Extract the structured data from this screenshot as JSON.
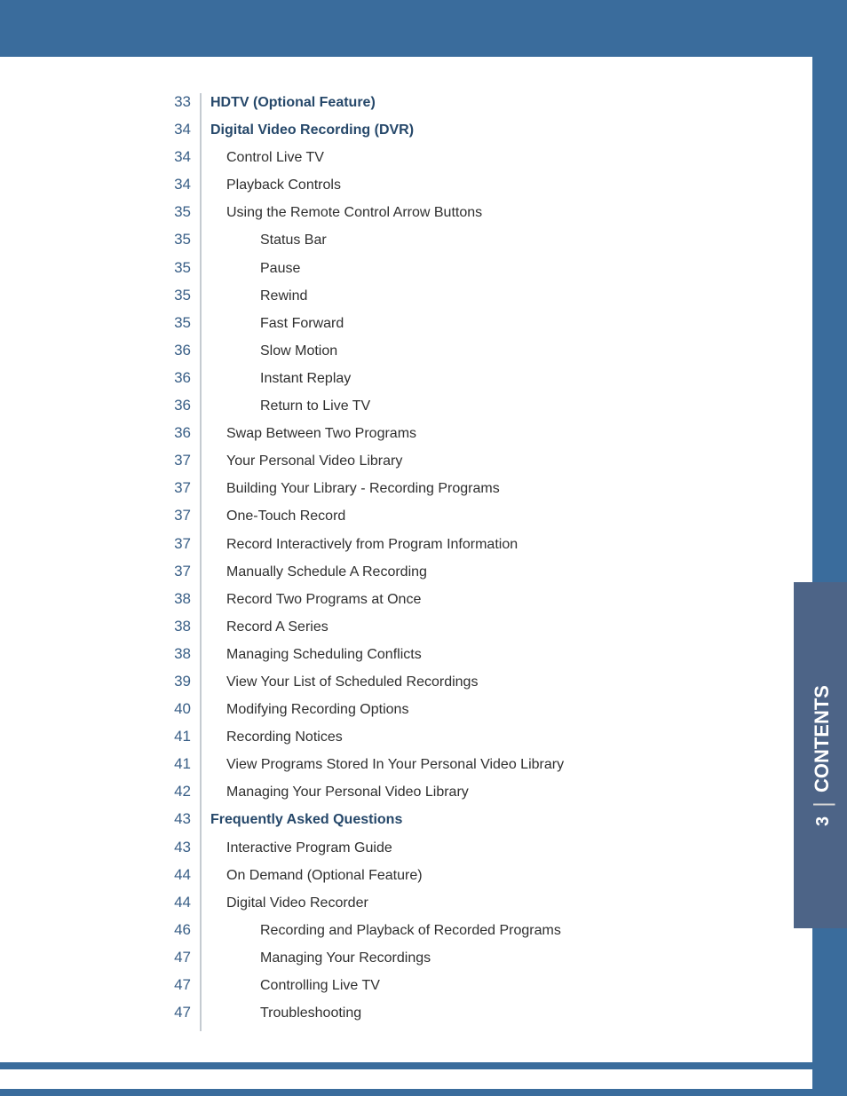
{
  "side_tab": {
    "page": "3",
    "separator": "|",
    "title": "CONTENTS"
  },
  "toc": [
    {
      "page": "33",
      "title": "HDTV  (Optional Feature)",
      "level": 0,
      "bold": true
    },
    {
      "page": "34",
      "title": "Digital Video Recording (DVR)",
      "level": 0,
      "bold": true
    },
    {
      "page": "34",
      "title": "Control Live TV",
      "level": 1,
      "bold": false
    },
    {
      "page": "34",
      "title": "Playback Controls",
      "level": 1,
      "bold": false
    },
    {
      "page": "35",
      "title": "Using the Remote Control Arrow Buttons",
      "level": 1,
      "bold": false
    },
    {
      "page": "35",
      "title": "Status Bar",
      "level": 2,
      "bold": false
    },
    {
      "page": "35",
      "title": "Pause",
      "level": 2,
      "bold": false
    },
    {
      "page": "35",
      "title": "Rewind",
      "level": 2,
      "bold": false
    },
    {
      "page": "35",
      "title": "Fast Forward",
      "level": 2,
      "bold": false
    },
    {
      "page": "36",
      "title": "Slow Motion",
      "level": 2,
      "bold": false
    },
    {
      "page": "36",
      "title": "Instant Replay",
      "level": 2,
      "bold": false
    },
    {
      "page": "36",
      "title": "Return to Live TV",
      "level": 2,
      "bold": false
    },
    {
      "page": "36",
      "title": "Swap Between Two Programs",
      "level": 1,
      "bold": false
    },
    {
      "page": "37",
      "title": "Your Personal Video Library",
      "level": 1,
      "bold": false
    },
    {
      "page": "37",
      "title": "Building Your Library - Recording Programs",
      "level": 1,
      "bold": false
    },
    {
      "page": "37",
      "title": "One-Touch Record",
      "level": 1,
      "bold": false
    },
    {
      "page": "37",
      "title": "Record Interactively from Program Information",
      "level": 1,
      "bold": false
    },
    {
      "page": "37",
      "title": "Manually Schedule A Recording",
      "level": 1,
      "bold": false
    },
    {
      "page": "38",
      "title": "Record Two Programs at Once",
      "level": 1,
      "bold": false
    },
    {
      "page": "38",
      "title": "Record A Series",
      "level": 1,
      "bold": false
    },
    {
      "page": "38",
      "title": "Managing Scheduling Conflicts",
      "level": 1,
      "bold": false
    },
    {
      "page": "39",
      "title": "View Your List of Scheduled Recordings",
      "level": 1,
      "bold": false
    },
    {
      "page": "40",
      "title": "Modifying Recording Options",
      "level": 1,
      "bold": false
    },
    {
      "page": "41",
      "title": "Recording Notices",
      "level": 1,
      "bold": false
    },
    {
      "page": "41",
      "title": "View Programs Stored In Your Personal Video Library",
      "level": 1,
      "bold": false
    },
    {
      "page": "42",
      "title": "Managing Your Personal Video Library",
      "level": 1,
      "bold": false
    },
    {
      "page": "43",
      "title": "Frequently Asked Questions",
      "level": 0,
      "bold": true
    },
    {
      "page": "43",
      "title": "Interactive Program Guide",
      "level": 1,
      "bold": false
    },
    {
      "page": "44",
      "title": "On Demand (Optional Feature)",
      "level": 1,
      "bold": false
    },
    {
      "page": "44",
      "title": "Digital Video Recorder",
      "level": 1,
      "bold": false
    },
    {
      "page": "46",
      "title": "Recording and Playback of Recorded Programs",
      "level": 2,
      "bold": false
    },
    {
      "page": "47",
      "title": "Managing Your Recordings",
      "level": 2,
      "bold": false
    },
    {
      "page": "47",
      "title": "Controlling Live TV",
      "level": 2,
      "bold": false
    },
    {
      "page": "47",
      "title": "Troubleshooting",
      "level": 2,
      "bold": false
    }
  ]
}
